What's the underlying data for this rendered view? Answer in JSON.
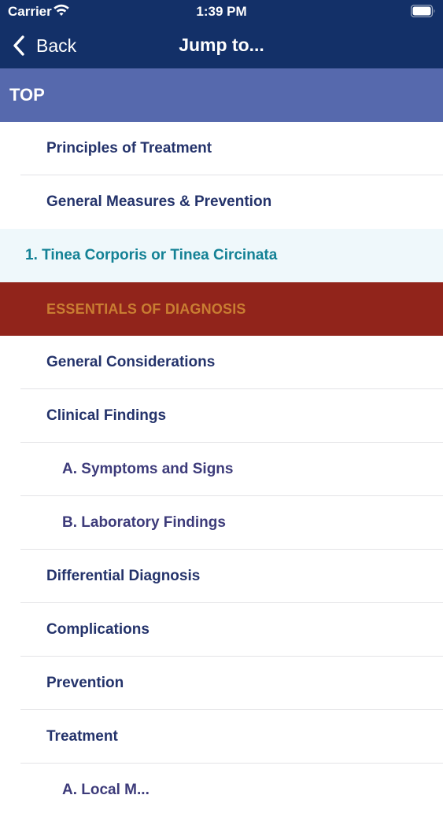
{
  "status_bar": {
    "carrier": "Carrier",
    "time": "1:39 PM",
    "wifi_icon": "wifi-icon",
    "battery_icon": "battery-icon"
  },
  "nav": {
    "back_label": "Back",
    "title": "Jump to...",
    "back_icon": "chevron-left-icon"
  },
  "colors": {
    "header_bg": "#133068",
    "top_section_bg": "#5669AD",
    "highlight_bg": "#EFF8FB",
    "highlight_text": "#138195",
    "essentials_bg": "#91241B",
    "essentials_text": "#C97D32",
    "item_text": "#24336B"
  },
  "list": {
    "top_label": "TOP",
    "items": [
      {
        "label": "Principles of Treatment"
      },
      {
        "label": "General Measures & Prevention"
      },
      {
        "label": "1. Tinea Corporis or Tinea Circinata"
      },
      {
        "label": "ESSENTIALS OF DIAGNOSIS"
      },
      {
        "label": "General Considerations"
      },
      {
        "label": "Clinical Findings"
      },
      {
        "label": "A. Symptoms and Signs"
      },
      {
        "label": "B. Laboratory Findings"
      },
      {
        "label": "Differential Diagnosis"
      },
      {
        "label": "Complications"
      },
      {
        "label": "Prevention"
      },
      {
        "label": "Treatment"
      },
      {
        "label": "A. Local M..."
      }
    ]
  }
}
